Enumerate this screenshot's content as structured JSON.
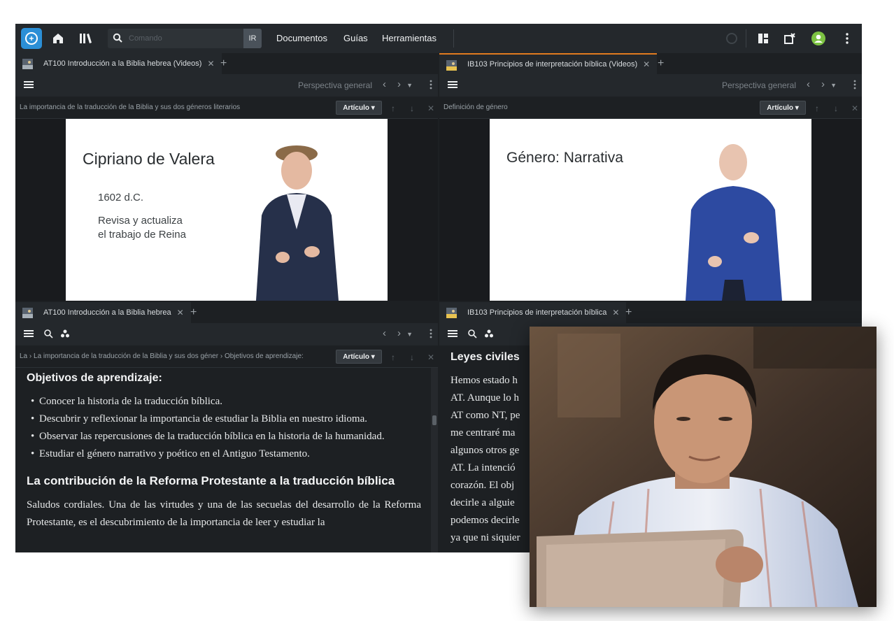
{
  "topbar": {
    "search_placeholder": "Comando",
    "go_label": "IR",
    "nav": [
      "Documentos",
      "Guías",
      "Herramientas"
    ]
  },
  "colors": {
    "accent": "#2b8fd6",
    "active_tab": "#e07a1f",
    "background": "#1d2023"
  },
  "panels": {
    "top_left": {
      "tab_title": "AT100 Introducción a la Biblia hebrea (Videos)",
      "perspective": "Perspectiva general",
      "breadcrumb": "La importancia de la traducción de la Biblia y sus dos géneros literarios",
      "article_button": "Artículo",
      "slide": {
        "title": "Cipriano de Valera",
        "line1": "1602 d.C.",
        "line2": "Revisa y actualiza",
        "line3": "el trabajo de Reina"
      }
    },
    "top_right": {
      "tab_title": "IB103 Principios de interpretación bíblica (Videos)",
      "perspective": "Perspectiva general",
      "breadcrumb": "Definición de género",
      "article_button": "Artículo",
      "slide": {
        "title": "Género: Narrativa"
      }
    },
    "bottom_left": {
      "tab_title": "AT100 Introducción a la Biblia hebrea",
      "breadcrumb": "La › La importancia de la traducción de la Biblia y sus dos géner › Objetivos de aprendizaje:",
      "article_button": "Artículo",
      "heading1": "Objetivos de aprendizaje:",
      "bullets": [
        "Conocer la historia de la traducción bíblica.",
        "Descubrir y reflexionar la importancia de estudiar la Biblia en nuestro idioma.",
        "Observar las repercusiones de la traducción bíblica en la historia de la humanidad.",
        "Estudiar el género narrativo y poético en el Antiguo Testamento."
      ],
      "heading2": "La contribución de la Reforma Protestante a la traducción bíblica",
      "paragraph": "Saludos cordiales. Una de las virtudes y una de las secuelas del desarrollo de la Reforma Protestante, es el descubrimiento de la importancia de leer y estudiar la"
    },
    "bottom_right": {
      "tab_title": "IB103 Principios de interpretación bíblica",
      "heading": "Leyes civiles",
      "lines": [
        "Hemos estado h",
        "AT. Aunque lo h",
        "AT como NT, pe",
        "me centraré ma",
        "algunos otros ge",
        "AT. La intenció",
        "corazón. El obj",
        "decirle a alguie",
        "podemos decirle",
        "ya que ni siquier"
      ]
    }
  }
}
